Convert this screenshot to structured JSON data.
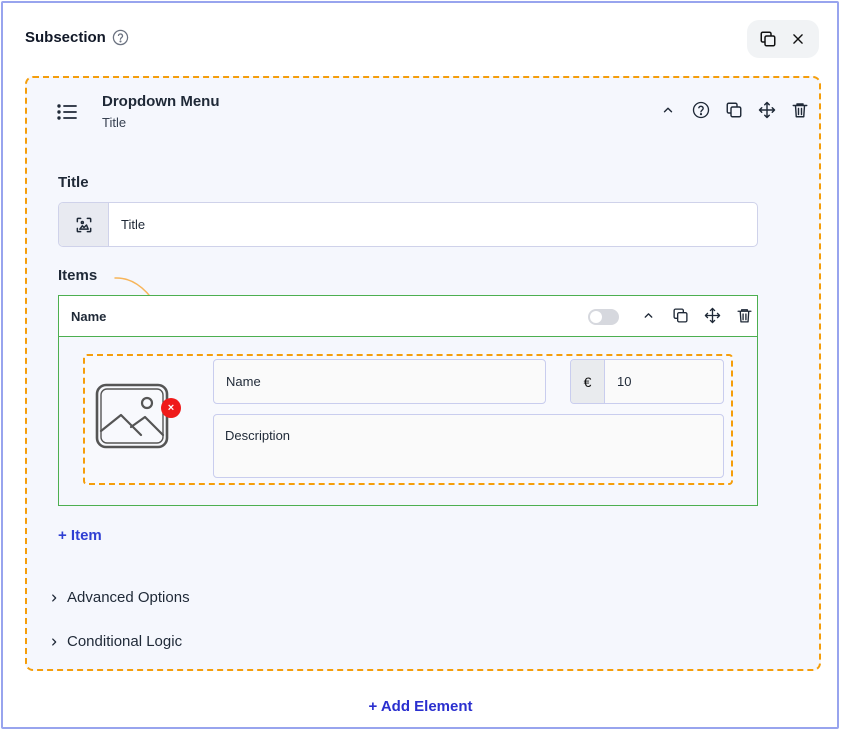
{
  "subsection": {
    "title": "Subsection",
    "icons": {
      "help": "help-circle-icon",
      "duplicate": "copy-icon",
      "close": "close-icon"
    }
  },
  "element": {
    "type_icon": "list-icon",
    "title": "Dropdown Menu",
    "subtitle": "Title",
    "actions": [
      "chevron-up-icon",
      "help-circle-icon",
      "copy-icon",
      "move-icon",
      "trash-icon"
    ]
  },
  "title_field": {
    "label": "Title",
    "value": "Title",
    "addon_icon": "image-text-icon"
  },
  "items_section": {
    "label": "Items",
    "header_name": "Name",
    "toggle_on": false,
    "actions": [
      "chevron-up-icon",
      "copy-icon",
      "move-icon",
      "trash-icon"
    ],
    "item": {
      "image_icon": "image-placeholder-icon",
      "remove_badge": "×",
      "name_value": "Name",
      "currency": "€",
      "price_value": "10",
      "description_value": "Description"
    },
    "add_item_label": "+ Item"
  },
  "advanced_options_label": "Advanced Options",
  "conditional_logic_label": "Conditional Logic",
  "add_element_label": "+ Add Element",
  "colors": {
    "frame_border": "#98a4ee",
    "dashed_accent": "#f59e0b",
    "items_border": "#4caf50",
    "link_blue": "#2f3fd3",
    "remove_red": "#ef1a1a"
  }
}
